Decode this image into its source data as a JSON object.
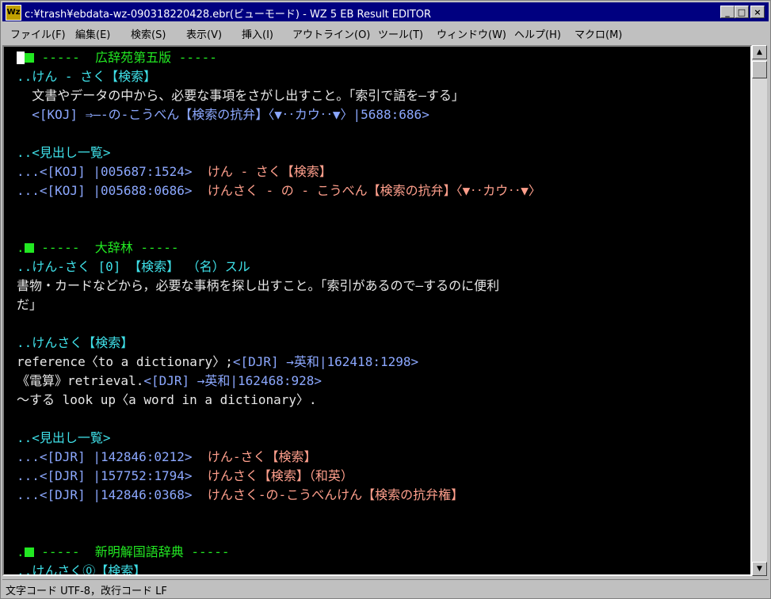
{
  "window": {
    "title": "c:¥trash¥ebdata-wz-090318220428.ebr(ビューモード) - WZ 5 EB Result EDITOR",
    "app_icon_text": "Wz",
    "controls": {
      "minimize": "_",
      "maximize": "□",
      "close": "×"
    }
  },
  "menu": [
    "ファイル(F)",
    "編集(E)",
    "検索(S)",
    "表示(V)",
    "挿入(I)",
    "アウトライン(O)",
    "ツール(T)",
    "ウィンドウ(W)",
    "ヘルプ(H)",
    "マクロ(M)"
  ],
  "lines": [
    {
      "segs": [
        {
          "t": "-----  広辞苑第五版 -----",
          "c": "green"
        }
      ],
      "lead": "cursor"
    },
    {
      "segs": [
        {
          "t": "..けん - さく【検索】",
          "c": "cyan"
        }
      ]
    },
    {
      "segs": [
        {
          "t": "  文書やデータの中から、必要な事項をさがし出すこと。「索引で語を―する」",
          "c": "white"
        }
      ]
    },
    {
      "segs": [
        {
          "t": "  <[KOJ] ⇒―-の-こうべん【検索の抗弁】〈▼‥カウ‥▼〉|5688:686>",
          "c": "blue"
        }
      ]
    },
    {
      "segs": []
    },
    {
      "segs": [
        {
          "t": "..<見出し一覧>",
          "c": "cyan"
        }
      ]
    },
    {
      "segs": [
        {
          "t": "...<[KOJ] |005687:1524>  ",
          "c": "blue"
        },
        {
          "t": "けん - さく【検索】",
          "c": "pink"
        }
      ]
    },
    {
      "segs": [
        {
          "t": "...<[KOJ] |005688:0686>  ",
          "c": "blue"
        },
        {
          "t": "けんさく - の - こうべん【検索の抗弁】〈▼‥カウ‥▼〉",
          "c": "pink"
        }
      ]
    },
    {
      "segs": []
    },
    {
      "segs": []
    },
    {
      "segs": [
        {
          "t": "-----  大辞林 -----",
          "c": "green"
        }
      ],
      "lead": "dot"
    },
    {
      "segs": [
        {
          "t": "..けん-さく [0] 【検索】 （名）スル",
          "c": "cyan"
        }
      ]
    },
    {
      "segs": [
        {
          "t": "書物・カードなどから，必要な事柄を探し出すこと。「索引があるので―するのに便利",
          "c": "white"
        }
      ]
    },
    {
      "segs": [
        {
          "t": "だ」",
          "c": "white"
        }
      ]
    },
    {
      "segs": []
    },
    {
      "segs": [
        {
          "t": "..けんさく【検索】",
          "c": "cyan"
        }
      ]
    },
    {
      "segs": [
        {
          "t": "reference〈to a dictionary〉;",
          "c": "white"
        },
        {
          "t": "<[DJR] →英和|162418:1298>",
          "c": "blue"
        }
      ]
    },
    {
      "segs": [
        {
          "t": "《電算》retrieval.",
          "c": "white"
        },
        {
          "t": "<[DJR] →英和|162468:928>",
          "c": "blue"
        }
      ]
    },
    {
      "segs": [
        {
          "t": "～する look up〈a word in a dictionary〉.",
          "c": "white"
        }
      ]
    },
    {
      "segs": []
    },
    {
      "segs": [
        {
          "t": "..<見出し一覧>",
          "c": "cyan"
        }
      ]
    },
    {
      "segs": [
        {
          "t": "...<[DJR] |142846:0212>  ",
          "c": "blue"
        },
        {
          "t": "けん-さく【検索】",
          "c": "pink"
        }
      ]
    },
    {
      "segs": [
        {
          "t": "...<[DJR] |157752:1794>  ",
          "c": "blue"
        },
        {
          "t": "けんさく【検索】（和英）",
          "c": "pink"
        }
      ]
    },
    {
      "segs": [
        {
          "t": "...<[DJR] |142846:0368>  ",
          "c": "blue"
        },
        {
          "t": "けんさく-の-こうべんけん【検索の抗弁権】",
          "c": "pink"
        }
      ]
    },
    {
      "segs": []
    },
    {
      "segs": []
    },
    {
      "segs": [
        {
          "t": "-----  新明解国語辞典 -----",
          "c": "green"
        }
      ],
      "lead": "dot"
    },
    {
      "segs": [
        {
          "t": "..けんさく⓪【検索】",
          "c": "cyan"
        }
      ]
    }
  ],
  "statusbar": {
    "text": "文字コード UTF-8，改行コード LF"
  }
}
